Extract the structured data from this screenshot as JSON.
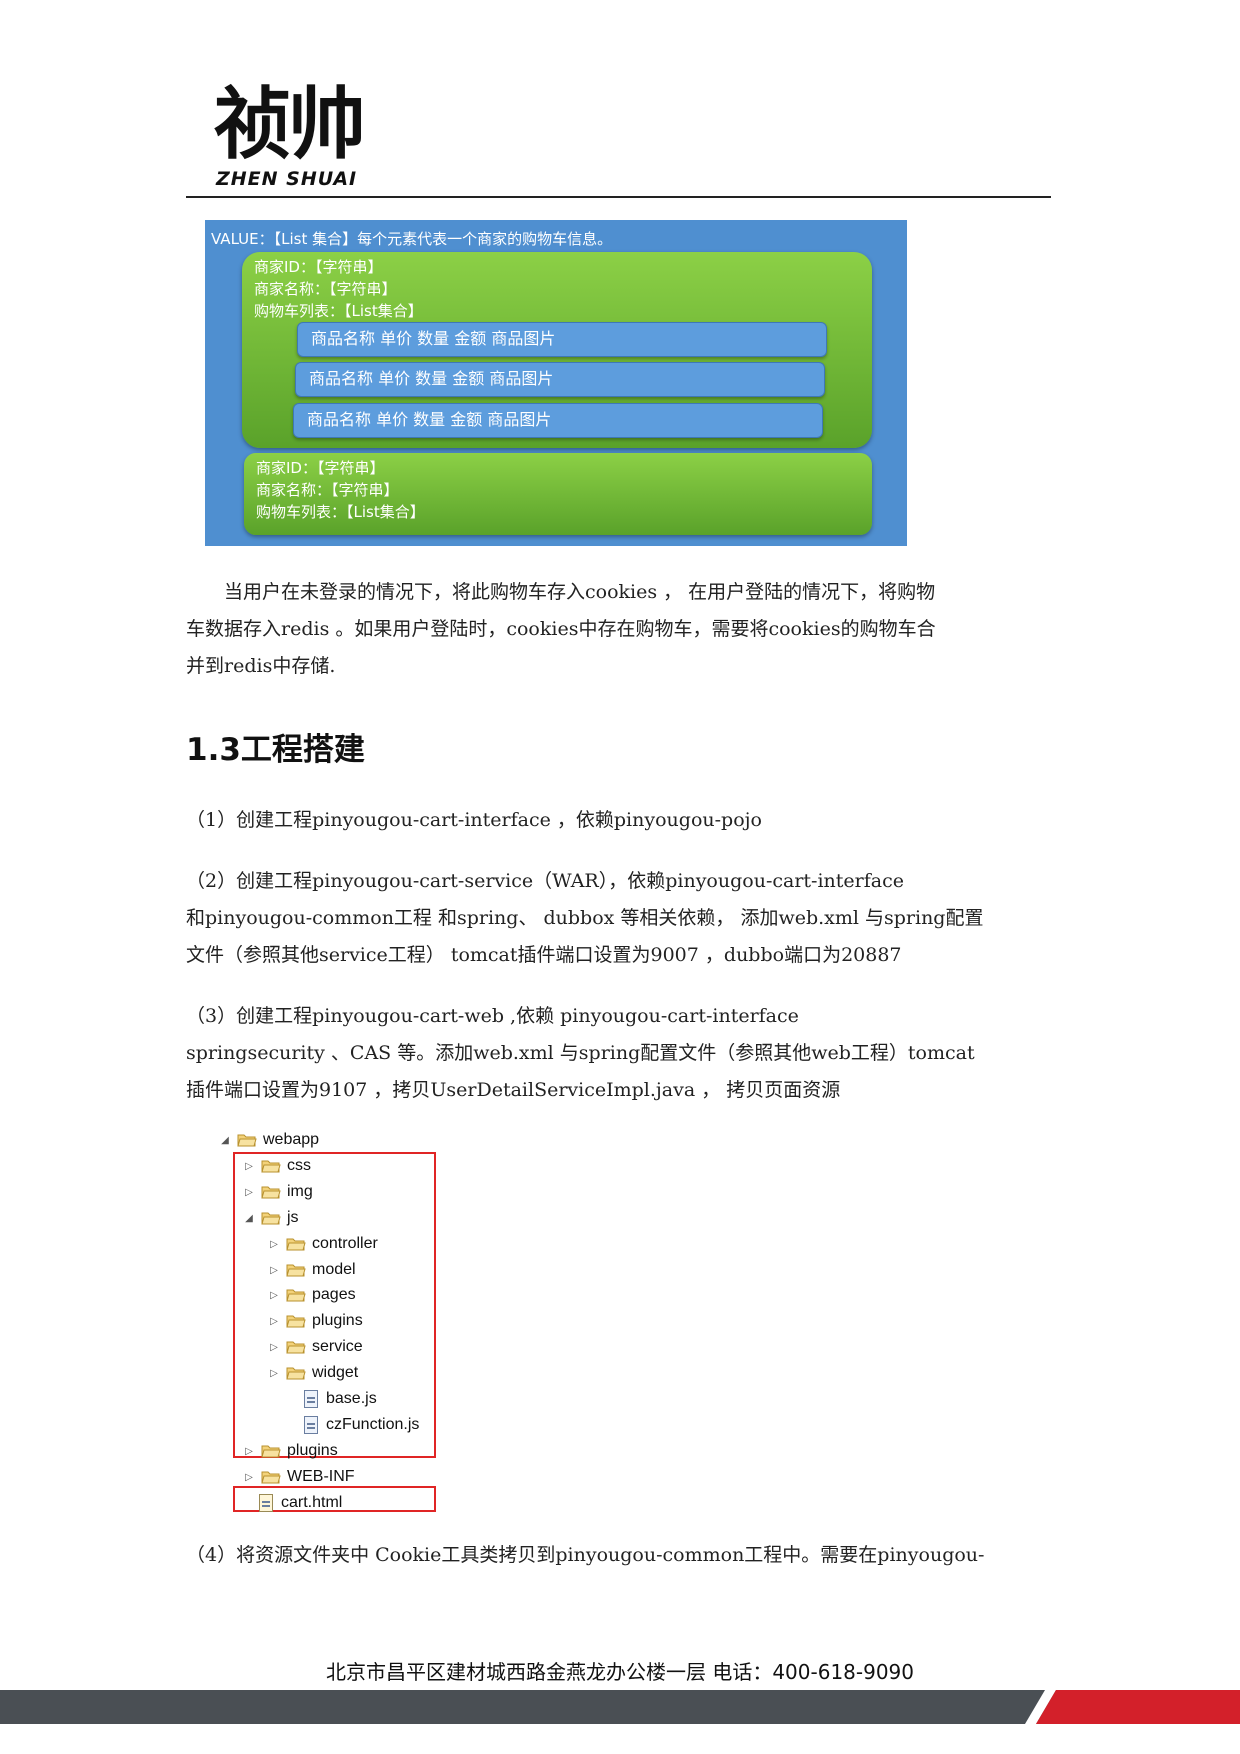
{
  "header": {
    "logo_cn": "祯帅",
    "logo_en": "ZHEN SHUAI"
  },
  "diagram": {
    "value_line": "VALUE：【List 集合】每个元素代表一个商家的购物车信息。",
    "merchant_1": {
      "id": "商家ID：【字符串】",
      "name": "商家名称：【字符串】",
      "cart_list": "购物车列表：【List集合】",
      "items": [
        "商品名称  单价  数量  金额  商品图片",
        "商品名称  单价  数量  金额  商品图片",
        "商品名称  单价  数量  金额  商品图片"
      ]
    },
    "merchant_2": {
      "id": "商家ID：【字符串】",
      "name": "商家名称：【字符串】",
      "cart_list": "购物车列表：【List集合】"
    }
  },
  "paragraph_1": [
    "　　当用户在未登录的情况下，将此购物车存入cookies ， 在用户登陆的情况下，将购物",
    "车数据存入redis  。如果用户登陆时，cookies中存在购物车，需要将cookies的购物车合",
    "并到redis中存储."
  ],
  "section_heading": "1.3工程搭建",
  "step_1": [
    "（1）创建工程pinyougou-cart-interface  ，依赖pinyougou-pojo"
  ],
  "step_2": [
    "（2）创建工程pinyougou-cart-service（WAR），依赖pinyougou-cart-interface",
    "和pinyougou-common工程 和spring、 dubbox  等相关依赖， 添加web.xml 与spring配置",
    "文件（参照其他service工程）  tomcat插件端口设置为9007  ，dubbo端口为20887"
  ],
  "step_3": [
    "（3）创建工程pinyougou-cart-web         ,依赖     pinyougou-cart-interface",
    "springsecurity 、CAS 等。添加web.xml 与spring配置文件（参照其他web工程）tomcat",
    "插件端口设置为9107 ，拷贝UserDetailServiceImpl.java  ，  拷贝页面资源"
  ],
  "file_tree": [
    {
      "label": "webapp",
      "kind": "folder",
      "expanded": true
    },
    {
      "label": "css",
      "kind": "folder",
      "expanded": false
    },
    {
      "label": "img",
      "kind": "folder",
      "expanded": false
    },
    {
      "label": "js",
      "kind": "folder",
      "expanded": true
    },
    {
      "label": "controller",
      "kind": "folder",
      "expanded": false
    },
    {
      "label": "model",
      "kind": "folder",
      "expanded": false
    },
    {
      "label": "pages",
      "kind": "folder",
      "expanded": false
    },
    {
      "label": "plugins",
      "kind": "folder",
      "expanded": false
    },
    {
      "label": "service",
      "kind": "folder",
      "expanded": false
    },
    {
      "label": "widget",
      "kind": "folder",
      "expanded": false
    },
    {
      "label": "base.js",
      "kind": "js-file"
    },
    {
      "label": "czFunction.js",
      "kind": "js-file"
    },
    {
      "label": "plugins",
      "kind": "folder",
      "expanded": false
    },
    {
      "label": "WEB-INF",
      "kind": "folder",
      "expanded": false
    },
    {
      "label": "cart.html",
      "kind": "html-file"
    }
  ],
  "step_4": [
    "（4）将资源文件夹中  Cookie工具类拷贝到pinyougou-common工程中。需要在pinyougou-"
  ],
  "footer": {
    "address": "北京市昌平区建材城西路金燕龙办公楼一层   电话：400-618-9090"
  },
  "colors": {
    "diagram_blue": "#4f8fd0",
    "diagram_green": "#6bb534",
    "highlight_red": "#e02525",
    "footer_gray": "#4a4f54",
    "footer_red": "#d3202a"
  }
}
